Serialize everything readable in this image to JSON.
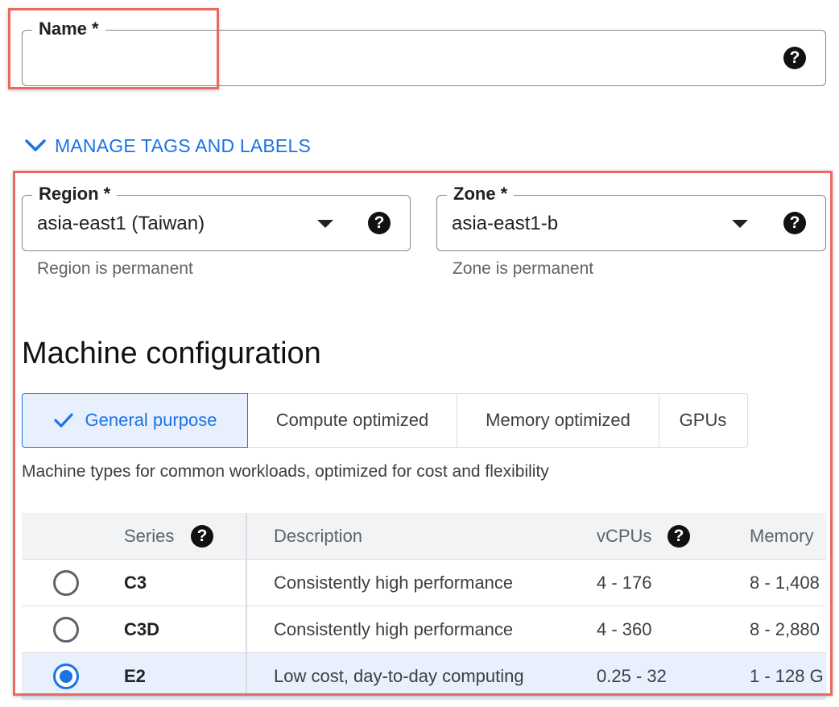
{
  "name_field": {
    "label": "Name *",
    "value": "",
    "help_icon": "help-icon"
  },
  "manage_tags": {
    "label": "MANAGE TAGS AND LABELS",
    "icon": "chevron-down-icon"
  },
  "region_field": {
    "label": "Region *",
    "value": "asia-east1 (Taiwan)",
    "helper": "Region is permanent"
  },
  "zone_field": {
    "label": "Zone *",
    "value": "asia-east1-b",
    "helper": "Zone is permanent"
  },
  "machine_config": {
    "title": "Machine configuration",
    "tabs": [
      {
        "label": "General purpose",
        "active": true
      },
      {
        "label": "Compute optimized",
        "active": false
      },
      {
        "label": "Memory optimized",
        "active": false
      },
      {
        "label": "GPUs",
        "active": false
      }
    ],
    "tab_description": "Machine types for common workloads, optimized for cost and flexibility"
  },
  "series_table": {
    "headers": {
      "series": "Series",
      "description": "Description",
      "vcpus": "vCPUs",
      "memory": "Memory"
    },
    "rows": [
      {
        "series": "C3",
        "description": "Consistently high performance",
        "vcpus": "4 - 176",
        "memory": "8 - 1,408",
        "selected": false
      },
      {
        "series": "C3D",
        "description": "Consistently high performance",
        "vcpus": "4 - 360",
        "memory": "8 - 2,880",
        "selected": false
      },
      {
        "series": "E2",
        "description": "Low cost, day-to-day computing",
        "vcpus": "0.25 - 32",
        "memory": "1 - 128 G",
        "selected": true
      }
    ]
  },
  "colors": {
    "accent": "#1a73e8",
    "annotation": "#ea6a5f",
    "selected_row": "#e8f0fe",
    "header_bg": "#f1f3f4"
  }
}
